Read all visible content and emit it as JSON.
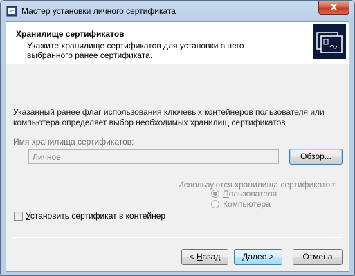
{
  "window": {
    "title": "Мастер установки личного сертификата",
    "close_glyph": "x"
  },
  "header": {
    "title": "Хранилище сертификатов",
    "description": "Укажите хранилище сертификатов для установки в него  выбранного ранее сертификата.",
    "graphic_icon": "certificate-icon"
  },
  "body": {
    "intro_text": "Указанный ранее флаг использования ключевых контейнеров пользователя или компьютера определяет выбор необходимых хранилищ сертификатов",
    "store_label": "Имя хранилища сертификатов:",
    "store_value": "Личное",
    "browse_button": {
      "prefix": "Об",
      "accel": "з",
      "suffix": "ор..."
    },
    "used_label": "Используются хранилища сертификатов:",
    "radio_user": {
      "accel": "П",
      "rest": "ользователя",
      "selected": true
    },
    "radio_computer": {
      "accel": "К",
      "rest": "омпьютера",
      "selected": false
    },
    "install_checkbox": {
      "accel": "У",
      "rest": "становить сертификат в контейнер",
      "checked": false
    }
  },
  "footer": {
    "back_button": {
      "prefix": "< ",
      "accel": "Н",
      "suffix": "азад"
    },
    "next_button": {
      "accel": "Д",
      "suffix": "алее >"
    },
    "cancel_button": "Отмена"
  }
}
